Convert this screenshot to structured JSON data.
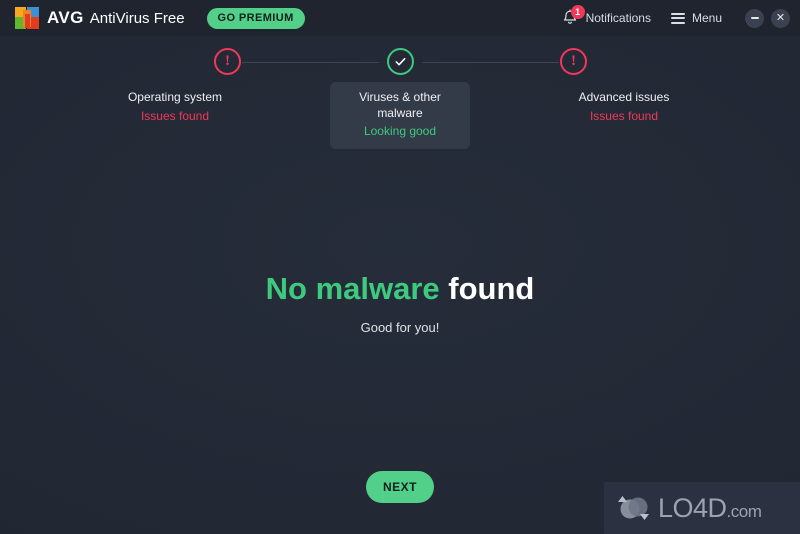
{
  "window": {
    "brand_short": "AVG",
    "brand_rest": "AntiVirus Free",
    "logo_icon": "avg-logo-icon",
    "go_premium_label": "GO PREMIUM",
    "notifications_label": "Notifications",
    "notifications_count": "1",
    "notifications_icon": "bell-icon",
    "menu_label": "Menu",
    "menu_icon": "hamburger-icon",
    "minimize_icon": "minimize-icon",
    "close_icon": "close-icon",
    "close_glyph": "✕"
  },
  "steps": [
    {
      "title": "Operating system",
      "status": "Issues found",
      "state": "issues",
      "icon": "exclamation-circle-icon",
      "glyph": "!"
    },
    {
      "title": "Viruses & other malware",
      "status": "Looking good",
      "state": "ok",
      "icon": "check-circle-icon",
      "glyph": "✓"
    },
    {
      "title": "Advanced issues",
      "status": "Issues found",
      "state": "issues",
      "icon": "exclamation-circle-icon",
      "glyph": "!"
    }
  ],
  "result": {
    "title_green": "No malware",
    "title_white": "found",
    "subtitle": "Good for you!"
  },
  "actions": {
    "next_label": "NEXT"
  },
  "watermark": {
    "name": "LO4D",
    "suffix": ".com",
    "icon": "lo4d-circles-icon"
  },
  "colors": {
    "background": "#222834",
    "titlebar": "#1f242f",
    "accent_green": "#52d08a",
    "status_green": "#3ec97e",
    "status_red": "#f2385a",
    "card": "#333b48",
    "text_primary": "#ffffff",
    "text_secondary": "#d9dde4"
  }
}
